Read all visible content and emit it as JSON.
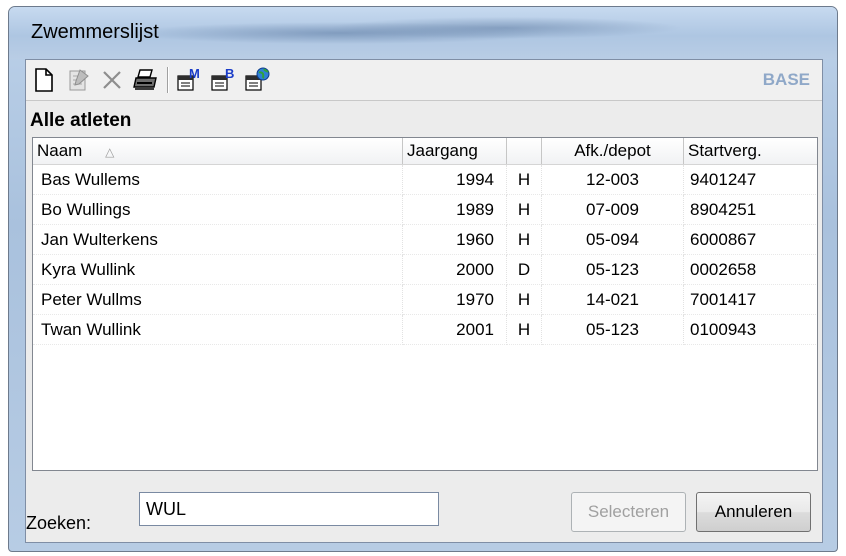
{
  "window": {
    "title": "Zwemmerslijst"
  },
  "toolbar": {
    "icons": [
      "new-document-icon",
      "edit-document-icon",
      "delete-icon",
      "print-icon",
      "report-m-icon",
      "report-b-icon",
      "report-web-icon"
    ],
    "base_label": "BASE"
  },
  "section": {
    "title": "Alle atleten"
  },
  "table": {
    "columns": [
      "Naam",
      "Jaargang",
      "",
      "Afk./depot",
      "Startverg."
    ],
    "rows": [
      {
        "naam": "Bas Wullems",
        "jaargang": "1994",
        "geslacht": "H",
        "afk": "12-003",
        "startverg": "9401247"
      },
      {
        "naam": "Bo Wullings",
        "jaargang": "1989",
        "geslacht": "H",
        "afk": "07-009",
        "startverg": "8904251"
      },
      {
        "naam": "Jan Wulterkens",
        "jaargang": "1960",
        "geslacht": "H",
        "afk": "05-094",
        "startverg": "6000867"
      },
      {
        "naam": "Kyra Wullink",
        "jaargang": "2000",
        "geslacht": "D",
        "afk": "05-123",
        "startverg": "0002658"
      },
      {
        "naam": "Peter Wullms",
        "jaargang": "1970",
        "geslacht": "H",
        "afk": "14-021",
        "startverg": "7001417"
      },
      {
        "naam": "Twan Wullink",
        "jaargang": "2001",
        "geslacht": "H",
        "afk": "05-123",
        "startverg": "0100943"
      }
    ]
  },
  "search": {
    "label": "Zoeken:",
    "value": "WUL"
  },
  "buttons": {
    "select": "Selecteren",
    "cancel": "Annuleren"
  }
}
